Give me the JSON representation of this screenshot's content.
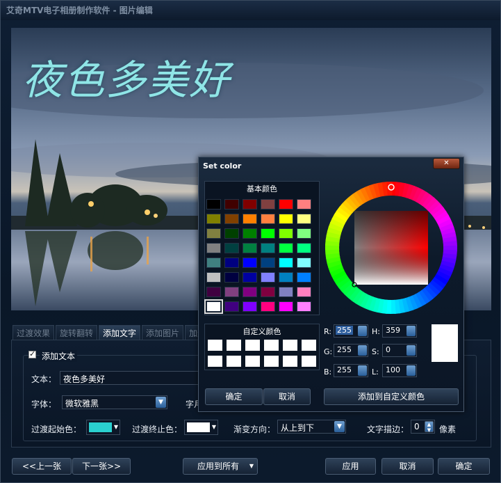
{
  "window": {
    "title": "艾奇MTV电子相册制作软件 - 图片编辑"
  },
  "preview": {
    "overlay_text": "夜色多美好",
    "overlay_color": "#8fe5e6"
  },
  "tabs": [
    "过渡效果",
    "旋转翻转",
    "添加文字",
    "添加图片",
    "加边"
  ],
  "active_tab": "添加文字",
  "text_panel": {
    "enable_label": "添加文本",
    "text_label": "文本：",
    "text_value": "夜色多美好",
    "font_label": "字体：",
    "font_value": "微软雅黑",
    "size_label_partial": "字月",
    "start_color_label": "过渡起始色：",
    "start_color": "#2ad0d0",
    "end_color_label": "过渡终止色：",
    "end_color": "#ffffff",
    "direction_label": "渐变方向：",
    "direction_value": "从上到下",
    "stroke_label": "文字描边：",
    "stroke_value": "0",
    "stroke_unit": "像素"
  },
  "bottom_bar": {
    "prev": "<<上一张",
    "next": "下一张>>",
    "apply_all": "应用到所有",
    "apply": "应用",
    "cancel": "取消",
    "ok": "确定"
  },
  "color_dialog": {
    "title": "Set color",
    "basic_label": "基本颜色",
    "custom_label": "自定义颜色",
    "basic_colors": [
      [
        "#000000",
        "#400000",
        "#800000",
        "#804040",
        "#ff0000",
        "#ff8080"
      ],
      [
        "#808000",
        "#804000",
        "#ff8000",
        "#ff8040",
        "#ffff00",
        "#ffff80"
      ],
      [
        "#808040",
        "#004000",
        "#008000",
        "#00ff00",
        "#80ff00",
        "#80ff80"
      ],
      [
        "#808080",
        "#004040",
        "#008040",
        "#008080",
        "#00ff40",
        "#00ff80"
      ],
      [
        "#408080",
        "#000080",
        "#0000ff",
        "#004080",
        "#00ffff",
        "#80ffff"
      ],
      [
        "#c0c0c0",
        "#000040",
        "#0000a0",
        "#8080ff",
        "#0080c0",
        "#0080ff"
      ],
      [
        "#400040",
        "#804080",
        "#800080",
        "#800040",
        "#8080c0",
        "#ff80c0"
      ],
      [
        "#ffffff",
        "#400080",
        "#8000ff",
        "#ff0080",
        "#ff00ff",
        "#ff80ff"
      ]
    ],
    "custom_colors": [
      "#ffffff",
      "#ffffff",
      "#ffffff",
      "#ffffff",
      "#ffffff",
      "#ffffff",
      "#ffffff",
      "#ffffff",
      "#ffffff",
      "#ffffff",
      "#ffffff",
      "#ffffff"
    ],
    "fields": {
      "r_label": "R:",
      "r": "255",
      "g_label": "G:",
      "g": "255",
      "b_label": "B:",
      "b": "255",
      "h_label": "H:",
      "h": "359",
      "s_label": "S:",
      "s": "0",
      "l_label": "L:",
      "l": "100"
    },
    "selected_color": "#ffffff",
    "ok": "确定",
    "cancel": "取消",
    "add_custom": "添加到自定义颜色"
  }
}
